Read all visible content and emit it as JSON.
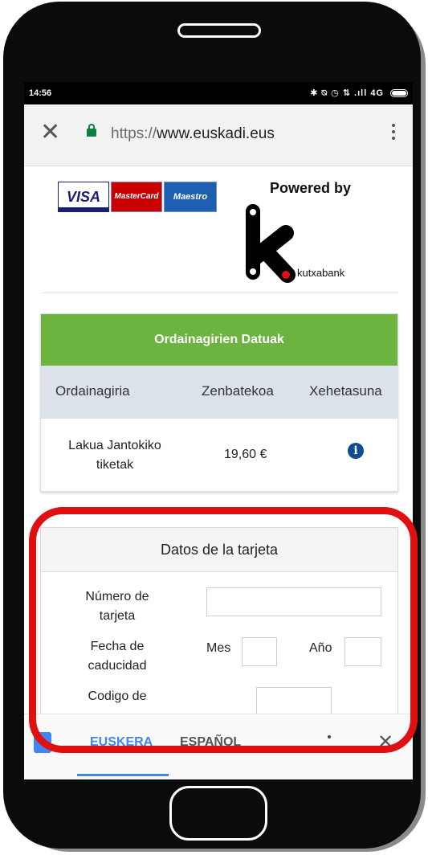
{
  "status_bar": {
    "time": "14:56",
    "icons": "✱ ⍉ ◷ ⇅ .ıll 4G"
  },
  "browser": {
    "url_protocol": "https://",
    "url_host": "www.euskadi.eus"
  },
  "payment_logos": {
    "visa": "VISA",
    "mastercard": "MasterCard",
    "maestro": "Maestro"
  },
  "powered_by": {
    "label": "Powered by",
    "bank_name": "kutxabank"
  },
  "invoice_panel": {
    "title": "Ordainagirien Datuak",
    "columns": [
      "Ordainagiria",
      "Zenbatekoa",
      "Xehetasuna"
    ],
    "rows": [
      {
        "name_line1": "Lakua Jantokiko",
        "name_line2": "tiketak",
        "amount": "19,60 €",
        "details_icon": "info-icon"
      }
    ]
  },
  "card_form": {
    "title": "Datos de la tarjeta",
    "card_number_label_line1": "Número de",
    "card_number_label_line2": "tarjeta",
    "card_number_value": "",
    "expiry_label_line1": "Fecha de",
    "expiry_label_line2": "caducidad",
    "month_label": "Mes",
    "month_value": "",
    "year_label": "Año",
    "year_value": "",
    "cvv_label_line1": "Codigo de",
    "cvv_value": ""
  },
  "translate_bar": {
    "languages": [
      "EUSKERA",
      "ESPAÑOL"
    ],
    "active_language": "EUSKERA",
    "active_color": "#4285f4"
  },
  "colors": {
    "header_green": "#6db33f",
    "highlight_red": "#e01010",
    "info_blue": "#0f4c92",
    "secure_green": "#0b8043"
  }
}
